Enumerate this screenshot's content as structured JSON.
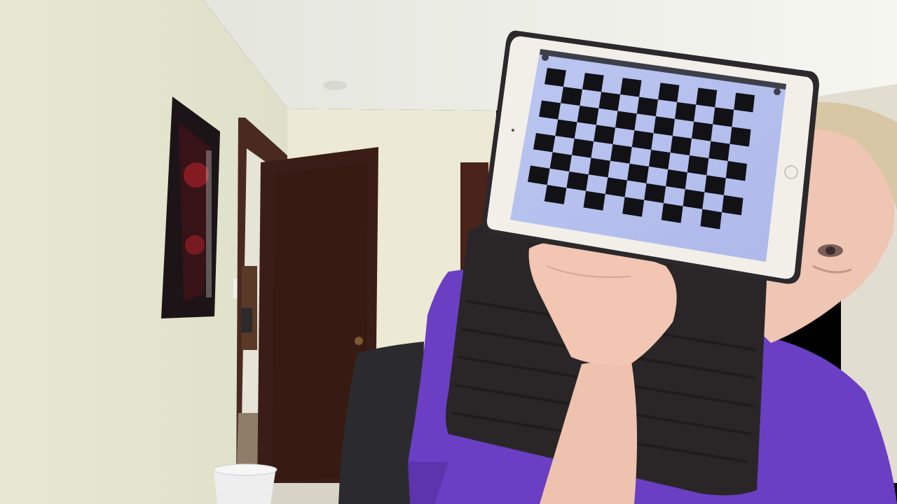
{
  "scene": {
    "description_tag": "webcam-photo",
    "tablet": {
      "pattern": "checkerboard",
      "rows": 8,
      "cols": 11
    },
    "colors": {
      "wall_left": "#e4e6cf",
      "wall_back": "#ecead6",
      "ceiling": "#e9eae4",
      "door": "#3a1d17",
      "door_frame": "#4a2a20",
      "poster": "#1c1416",
      "poster_accent": "#a5202a",
      "shirt": "#6a3fc3",
      "case": "#2a2628",
      "tablet_bezel": "#f1efe8",
      "screen": "#b9c3ee",
      "square": "#111116",
      "skin": "#efc5b4",
      "hair": "#d7c7a4",
      "chair": "#2b2b2f",
      "bin": "#eeeeee"
    }
  }
}
